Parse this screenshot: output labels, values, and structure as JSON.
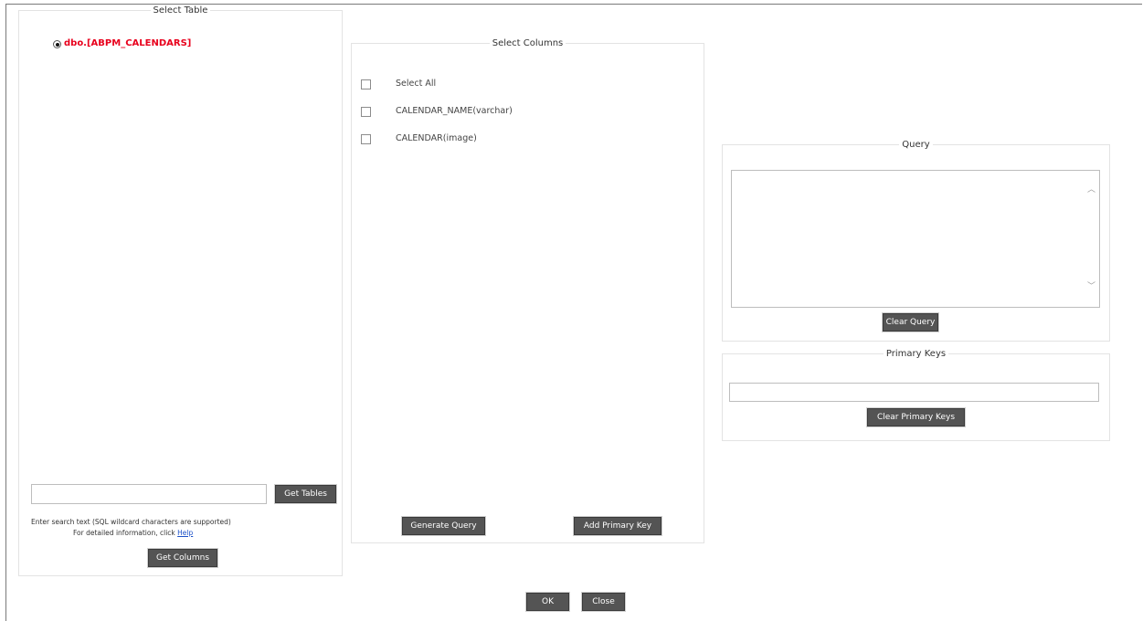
{
  "select_table": {
    "legend": "Select Table",
    "table_name": "dbo.[ABPM_CALENDARS]",
    "search_value": "",
    "get_tables_label": "Get Tables",
    "hint_text": "Enter search text (SQL wildcard characters are supported)",
    "help_prefix": "For detailed information, click",
    "help_link": "Help",
    "get_columns_label": "Get Columns"
  },
  "select_columns": {
    "legend": "Select Columns",
    "items": [
      {
        "label": "Select All",
        "checked": false
      },
      {
        "label": "CALENDAR_NAME(varchar)",
        "checked": false
      },
      {
        "label": "CALENDAR(image)",
        "checked": false
      }
    ],
    "generate_query_label": "Generate Query",
    "add_primary_key_label": "Add Primary Key"
  },
  "query": {
    "legend": "Query",
    "value": "",
    "clear_label": "Clear Query"
  },
  "primary_keys": {
    "legend": "Primary Keys",
    "value": "",
    "clear_label": "Clear Primary Keys"
  },
  "footer": {
    "ok_label": "OK",
    "close_label": "Close"
  },
  "colors": {
    "button_bg": "#545454",
    "table_link": "#e8001c",
    "border": "#e3e3e3"
  }
}
